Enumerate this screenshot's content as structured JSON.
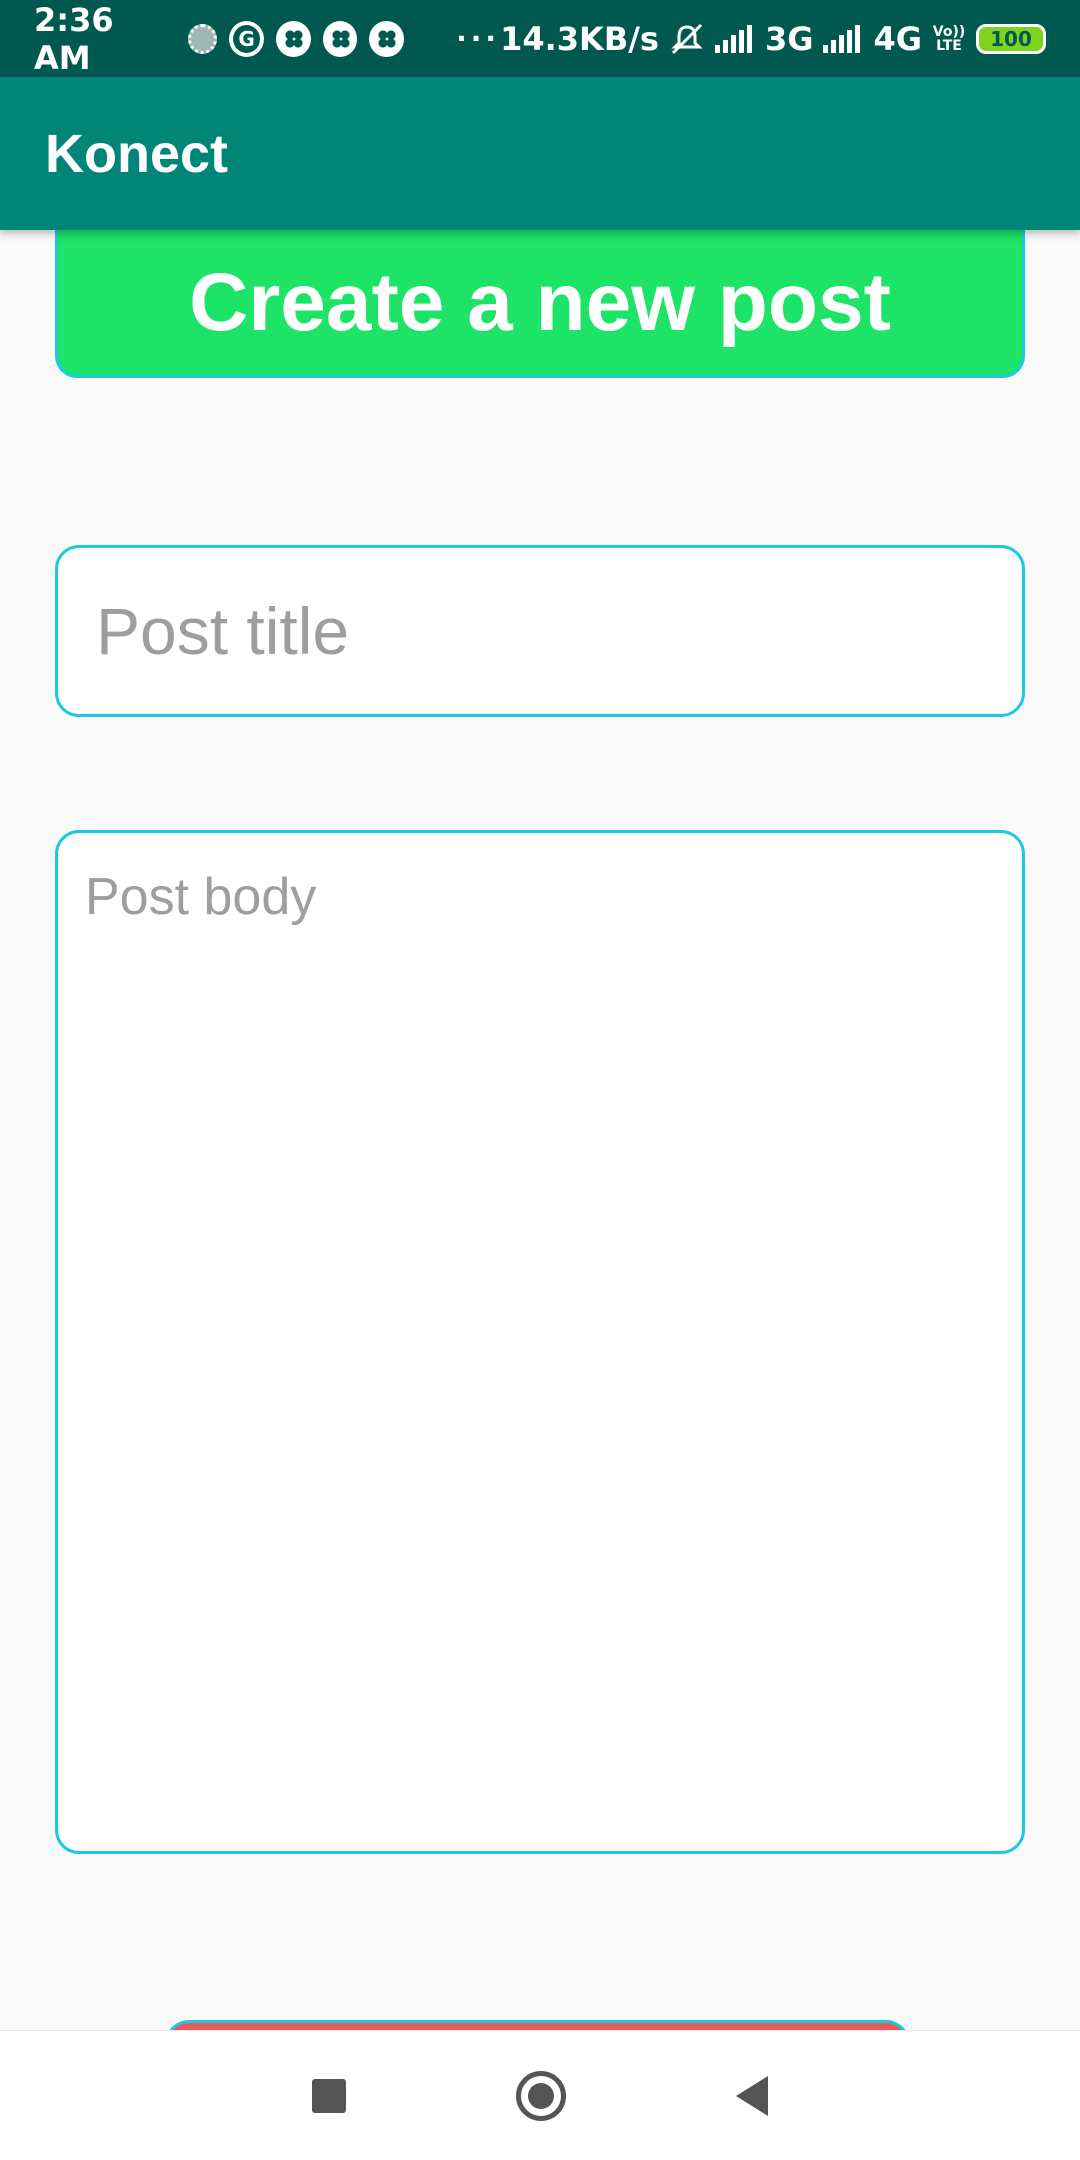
{
  "status_bar": {
    "time": "2:36 AM",
    "network_speed": "14.3KB/s",
    "network_1": "3G",
    "network_2": "4G",
    "volte_top": "Vo))",
    "volte_bottom": "LTE",
    "battery": "100",
    "icons": [
      "loading-icon",
      "g-icon",
      "clover-icon",
      "clover-icon",
      "clover-icon",
      "more-icon",
      "mute-icon",
      "signal-icon",
      "signal-icon"
    ]
  },
  "app_bar": {
    "title": "Konect"
  },
  "main": {
    "header_button_label": "Create a new post",
    "title_placeholder": "Post title",
    "body_placeholder": "Post body"
  },
  "colors": {
    "status_bar": "#00584f",
    "app_bar": "#008577",
    "header_button": "#1de466",
    "field_border": "#1dc9e0",
    "bottom_button": "#e85b5b",
    "placeholder": "#9e9e9e"
  },
  "nav_bar": {
    "icons": [
      "recents-icon",
      "home-icon",
      "back-icon"
    ]
  }
}
